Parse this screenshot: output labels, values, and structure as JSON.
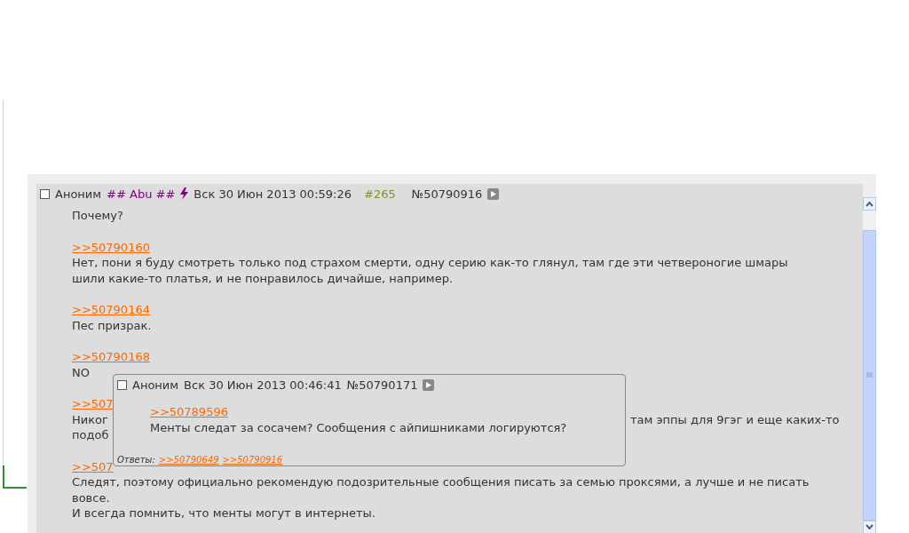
{
  "post": {
    "header": {
      "checked": false,
      "name": "Аноним",
      "trip": "## Abu ##",
      "date": "Вск 30 Июн 2013 00:59:26",
      "post_count": "#265",
      "number": "№50790916"
    },
    "paragraphs": [
      {
        "lines": [
          {
            "text": "Почему?"
          }
        ]
      },
      {
        "link": ">>50790160",
        "lines": [
          {
            "text": "Нет, пони я буду смотреть только под страхом смерти, одну серию как-то глянул, там где эти четвероногие шмары"
          },
          {
            "text": "шили какие-то платья, и не понравилось дичайше, например."
          }
        ]
      },
      {
        "link": ">>50790164",
        "lines": [
          {
            "text": "Пес призрак."
          }
        ]
      },
      {
        "link": ">>50790168",
        "lines": [
          {
            "text": "NO"
          }
        ]
      },
      {
        "link": ">>507",
        "lines": [
          {
            "text": "Никог",
            "after_popup": "там эппы для 9гэг и еще каких-то"
          },
          {
            "text": "подоб"
          }
        ]
      },
      {
        "link": ">>507",
        "lines": [
          {
            "text": "Следят, поэтому официально рекомендую подозрительные сообщения писать за семью проксями, а лучше и не писать"
          },
          {
            "text": "вовсе."
          },
          {
            "text": "И всегда помнить, что менты могут в интернеты."
          }
        ]
      }
    ]
  },
  "popup": {
    "header": {
      "checked": false,
      "name": "Аноним",
      "date": "Вск 30 Июн 2013 00:46:41",
      "number": "№50790171"
    },
    "link": ">>50789596",
    "text": "Менты следат за сосачем? Сообщения с айпишниками логируются?",
    "replies_label": "Ответы:",
    "replies": [
      ">>50790649",
      ">>50790916"
    ]
  }
}
